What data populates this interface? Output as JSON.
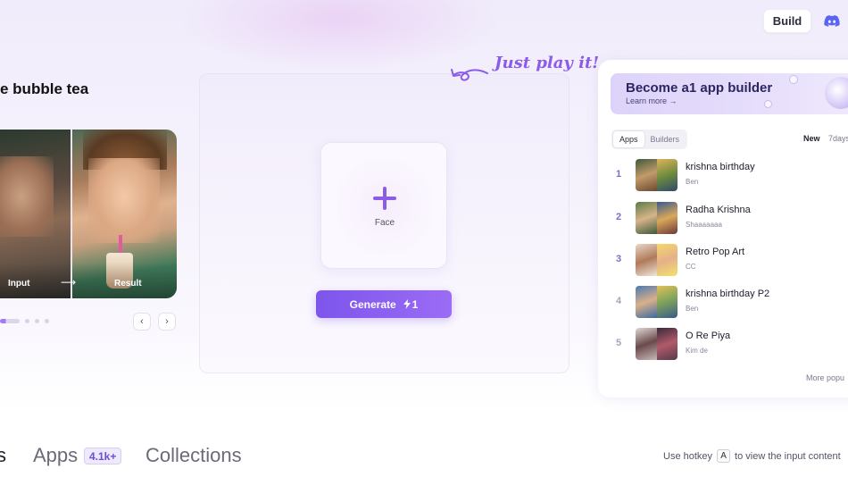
{
  "header": {
    "build_label": "Build",
    "discord_icon": "discord-icon"
  },
  "showcase": {
    "title": "e bubble tea",
    "input_label": "Input",
    "arrow": "⟶",
    "result_label": "Result",
    "prev_icon": "‹",
    "next_icon": "›"
  },
  "playground": {
    "tagline": "Just play it!",
    "face_label": "Face",
    "generate_label": "Generate",
    "generate_cost": "1",
    "accent": "#7d55ec"
  },
  "leaderboard": {
    "banner_title": "Become a1 app builder",
    "banner_link": "Learn more →",
    "tabs": [
      "Apps",
      "Builders"
    ],
    "sort": [
      "New",
      "7days"
    ],
    "items": [
      {
        "rank": "1",
        "name": "krishna birthday",
        "author": "Ben"
      },
      {
        "rank": "2",
        "name": "Radha Krishna",
        "author": "Shaaaaaaa"
      },
      {
        "rank": "3",
        "name": "Retro Pop Art",
        "author": "CC"
      },
      {
        "rank": "4",
        "name": "krishna birthday P2",
        "author": "Ben"
      },
      {
        "rank": "5",
        "name": "O Re Piya",
        "author": "Kim de"
      }
    ],
    "more_label": "More popu"
  },
  "bottom_tabs": {
    "partial": "s",
    "apps_label": "Apps",
    "apps_count": "4.1k+",
    "collections_label": "Collections"
  },
  "hotkey": {
    "prefix": "Use hotkey",
    "key": "A",
    "suffix": "to view the input content"
  }
}
